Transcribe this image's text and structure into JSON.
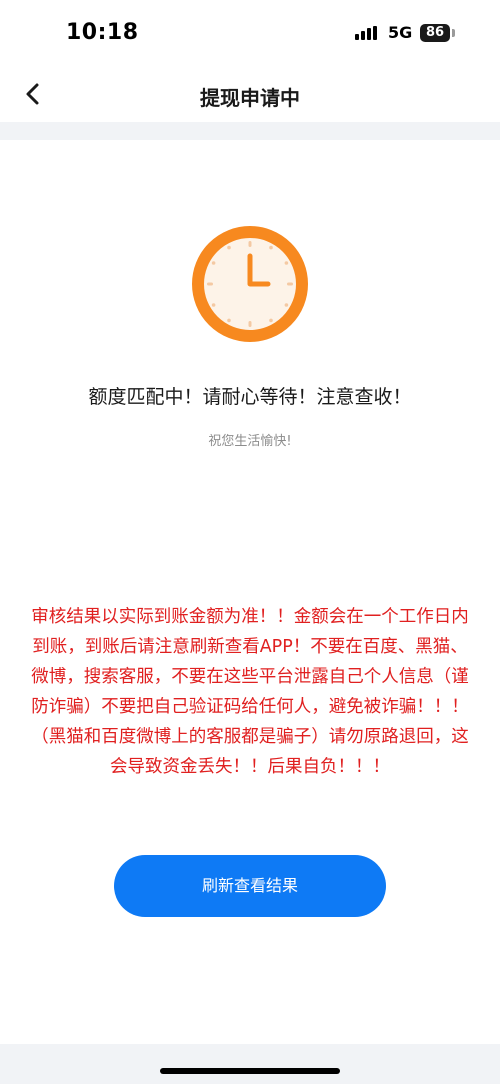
{
  "status_bar": {
    "time": "10:18",
    "network": "5G",
    "battery": "86"
  },
  "nav": {
    "title": "提现申请中",
    "back_icon": "chevron-left-icon"
  },
  "main": {
    "icon": "clock-icon",
    "message": "额度匹配中！请耐心等待！注意查收！",
    "sub_message": "祝您生活愉快!",
    "notice": "审核结果以实际到账金额为准！！金额会在一个工作日内到账，到账后请注意刷新查看APP！不要在百度、黑猫、微博，搜索客服，不要在这些平台泄露自己个人信息（谨防诈骗）不要把自己验证码给任何人，避免被诈骗！！！（黑猫和百度微博上的客服都是骗子）请勿原路退回，这会导致资金丢失！！后果自负！！！",
    "refresh_button": "刷新查看结果"
  },
  "colors": {
    "accent": "#0e7af5",
    "clock_ring": "#f7891f",
    "clock_face": "#fdf3e8",
    "warning": "#e02020"
  }
}
